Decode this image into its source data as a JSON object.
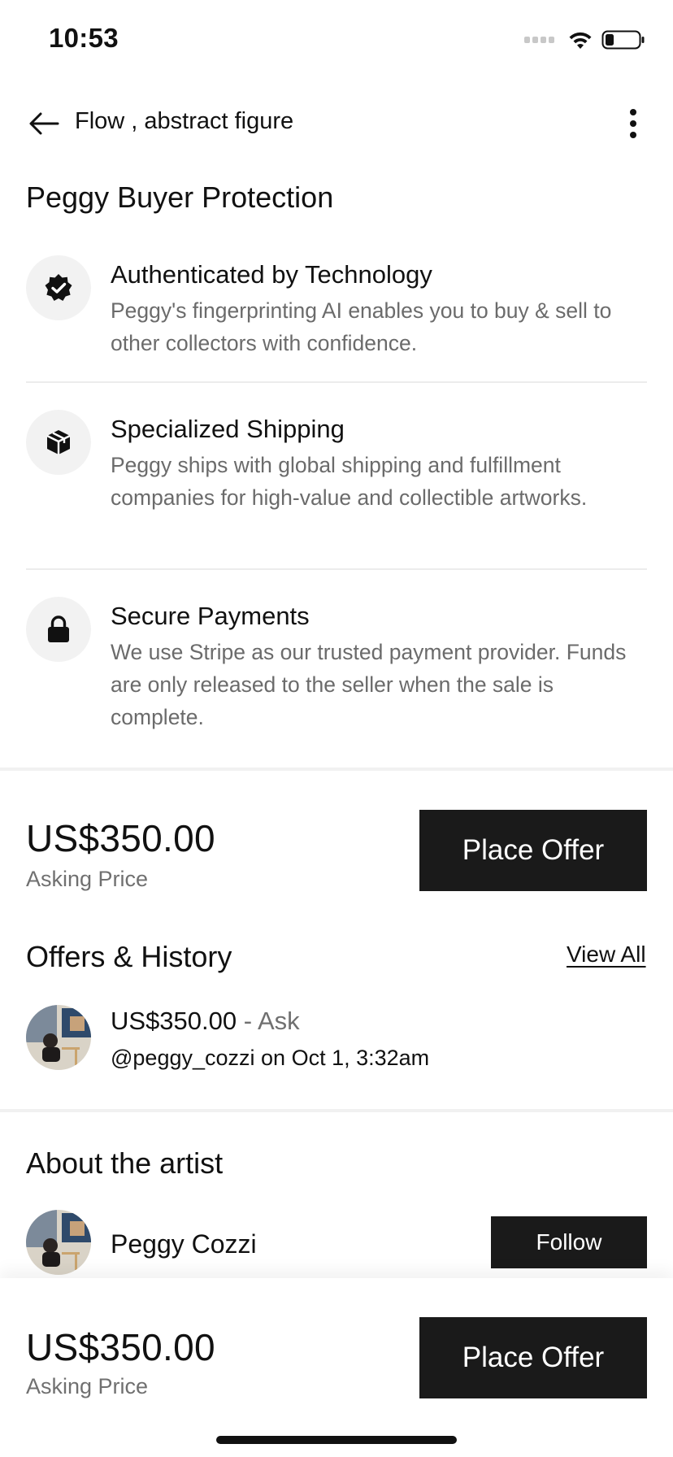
{
  "status_bar": {
    "time": "10:53"
  },
  "nav": {
    "title": "Flow , abstract figure",
    "back_icon": "arrow-left-icon",
    "more_icon": "more-vertical-icon"
  },
  "protection": {
    "heading": "Peggy Buyer Protection",
    "items": [
      {
        "icon": "verified-badge-icon",
        "title": "Authenticated by Technology",
        "description": "Peggy's fingerprinting AI enables you to buy & sell to other collectors with confidence."
      },
      {
        "icon": "package-box-icon",
        "title": "Specialized Shipping",
        "description": "Peggy ships with global shipping and fulfillment companies for high-value and collectible artworks."
      },
      {
        "icon": "lock-icon",
        "title": "Secure Payments",
        "description": "We use Stripe as our trusted payment provider. Funds are only released to the seller when the sale is complete."
      }
    ]
  },
  "pricing": {
    "price": "US$350.00",
    "label": "Asking Price",
    "button": "Place Offer"
  },
  "offers": {
    "heading": "Offers & History",
    "view_all": "View All",
    "items": [
      {
        "amount": "US$350.00",
        "type": "- Ask",
        "user": "@peggy_cozzi",
        "date": "on Oct 1, 3:32am"
      }
    ]
  },
  "artist": {
    "heading": "About the artist",
    "name": "Peggy Cozzi",
    "follow_label": "Follow"
  },
  "bottom_bar": {
    "price": "US$350.00",
    "label": "Asking Price",
    "button": "Place Offer"
  },
  "colors": {
    "primary_button": "#1a1a1a",
    "muted_text": "#6b6b6b",
    "icon_circle": "#f2f2f2"
  }
}
